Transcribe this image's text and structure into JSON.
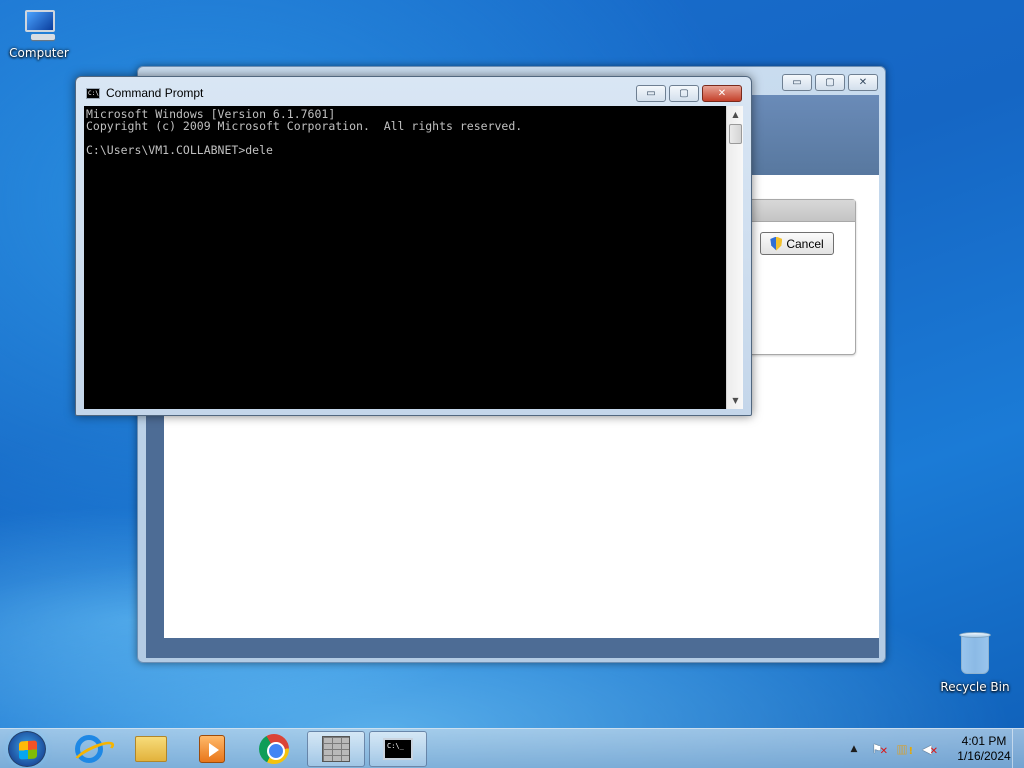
{
  "desktop": {
    "icons": [
      {
        "label": "Computer",
        "icon": "computer-icon"
      },
      {
        "label": "Recycle Bin",
        "icon": "recycle-bin-icon"
      }
    ]
  },
  "background_window": {
    "cancel_label": "Cancel",
    "buttons": {
      "minimize": "▭",
      "maximize": "▢",
      "close": "✕"
    }
  },
  "cmd": {
    "title": "Command Prompt",
    "icon_text": "C:\\",
    "lines": [
      "Microsoft Windows [Version 6.1.7601]",
      "Copyright (c) 2009 Microsoft Corporation.  All rights reserved.",
      "",
      "C:\\Users\\VM1.COLLABNET>dele"
    ],
    "buttons": {
      "minimize": "▭",
      "maximize": "▢",
      "close": "✕"
    }
  },
  "taskbar": {
    "items": [
      {
        "name": "internet-explorer",
        "icon": "ie-icon"
      },
      {
        "name": "windows-explorer",
        "icon": "folder-icon"
      },
      {
        "name": "windows-media-player",
        "icon": "media-player-icon"
      },
      {
        "name": "google-chrome",
        "icon": "chrome-icon"
      },
      {
        "name": "setup-program",
        "icon": "brick-wall-icon"
      },
      {
        "name": "command-prompt",
        "icon": "cmd-icon",
        "active": true
      }
    ],
    "cmd_icon_text": "C:\\_",
    "tray": {
      "show_hidden": "▲",
      "time": "4:01 PM",
      "date": "1/16/2024"
    }
  }
}
